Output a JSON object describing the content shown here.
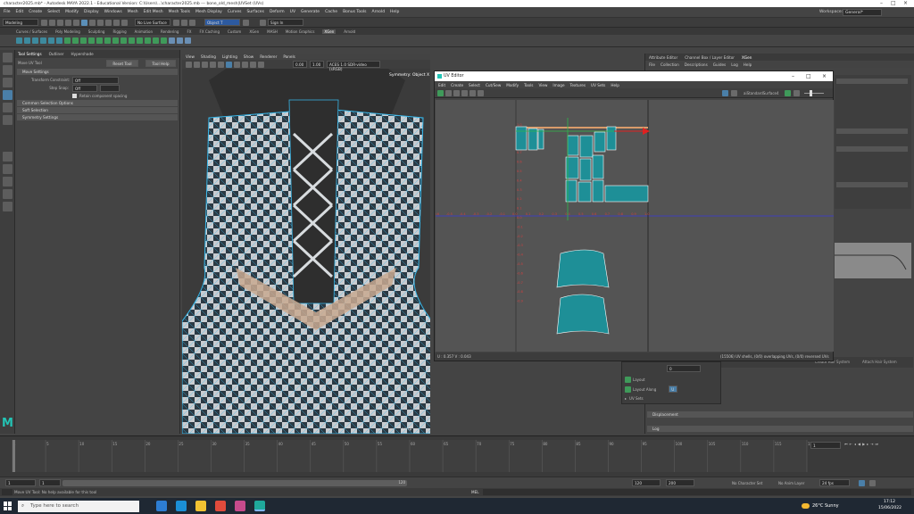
{
  "window": {
    "title": "character2025.mb* - Autodesk MAYA 2022.1 - Educational Version: C:\\Users\\...\\character2025.mb --- bone_old_mesh|UVSet (UVs)",
    "workspace_label": "Workspace:",
    "workspace_value": "General*"
  },
  "menubar": [
    "File",
    "Edit",
    "Create",
    "Select",
    "Modify",
    "Display",
    "Windows",
    "Mesh",
    "Edit Mesh",
    "Mesh Tools",
    "Mesh Display",
    "Curves",
    "Surfaces",
    "Deform",
    "UV",
    "Generate",
    "Cache",
    "Bonus Tools",
    "Arnold",
    "Help"
  ],
  "statusline": {
    "mode": "Modeling",
    "live_surface": "No Live Surface",
    "object_field": "Object T",
    "sign_in": "Sign In"
  },
  "shelf_tabs": [
    "Curves / Surfaces",
    "Poly Modeling",
    "Sculpting",
    "Rigging",
    "Animation",
    "Rendering",
    "FX",
    "FX Caching",
    "Custom",
    "XGen",
    "MASH",
    "Motion Graphics",
    "XGen",
    "Arnold"
  ],
  "tool_panel": {
    "tabs": [
      "Tool Settings",
      "Outliner",
      "Hypershade"
    ],
    "tool_name": "Move UV Tool",
    "reset_label": "Reset Tool",
    "help_label": "Tool Help",
    "sections": [
      "Move Settings",
      "Common Selection Options",
      "Soft Selection",
      "Symmetry Settings"
    ],
    "transform_constraint_label": "Transform Constraint:",
    "transform_constraint_value": "Off",
    "step_snap_label": "Step Snap:",
    "step_snap_value": "Off",
    "retain_label": "Retain component spacing"
  },
  "viewport": {
    "menu": [
      "View",
      "Shading",
      "Lighting",
      "Show",
      "Renderer",
      "Panels"
    ],
    "symmetry_label": "Symmetry: Object X",
    "field_a": "0.00",
    "field_b": "1.00",
    "colorspace": "ACES 1.0 SDR-video (sRGB)",
    "camera_label": "persp"
  },
  "uv_editor": {
    "title": "UV Editor",
    "menu": [
      "Edit",
      "Create",
      "Select",
      "Cut/Sew",
      "Modify",
      "Tools",
      "View",
      "Image",
      "Textures",
      "UV Sets",
      "Help"
    ],
    "shader_label": "aiStandardSurface4",
    "coords": "U : 0.357  V : 0.043",
    "shell_info": "(15506) UV shells, (0/0) overlapping UVs, (0/0) reversed UVs",
    "v_ticks": [
      "1.0",
      "0.9",
      "0.8",
      "0.7",
      "0.6",
      "0.5",
      "0.4",
      "0.3",
      "0.2",
      "0.1",
      "0.0",
      "-0.1",
      "-0.2",
      "-0.3",
      "-0.4",
      "-0.5",
      "-0.6",
      "-0.7",
      "-0.8",
      "-0.9"
    ],
    "u_ticks": [
      "-0.9",
      "-0.8",
      "-0.7",
      "-0.6",
      "-0.5",
      "-0.4",
      "-0.3",
      "-0.2",
      "-0.1",
      "0.0",
      "0.1",
      "0.2",
      "0.3",
      "0.4",
      "0.5",
      "0.6",
      "0.7",
      "0.8",
      "0.9",
      "1.0"
    ]
  },
  "attribute_editor": {
    "tabs": [
      "Attribute Editor",
      "Channel Box / Layer Editor",
      "XGen"
    ],
    "menu": [
      "File",
      "Collection",
      "Descriptions",
      "Guides",
      "Log",
      "Help"
    ],
    "layout_label": "Layout",
    "layout_along_label": "Layout Along",
    "layout_along_value": "U",
    "uv_sets_label": "UV Sets",
    "displacement_label": "Displacement",
    "log_label": "Log",
    "create_hair_label": "Create Hair System",
    "attach_hair_label": "Attach Hair System",
    "zero_value": "0"
  },
  "timeline": {
    "ticks": [
      "1",
      "5",
      "10",
      "15",
      "20",
      "25",
      "30",
      "35",
      "40",
      "45",
      "50",
      "55",
      "60",
      "65",
      "70",
      "75",
      "80",
      "85",
      "90",
      "95",
      "100",
      "105",
      "110",
      "115",
      "120"
    ],
    "current_frame": "1"
  },
  "range": {
    "start": "1",
    "inner_start": "1",
    "inner_end": "120",
    "end_a": "120",
    "end_b": "200",
    "character_set": "No Character Set",
    "anim_layer": "No Anim Layer",
    "fps": "24 fps"
  },
  "command_line": {
    "mel_label": "MEL",
    "help_text": "Move UV Tool: No help available for this tool"
  },
  "taskbar": {
    "search_placeholder": "Type here to search",
    "weather": "26°C  Sunny",
    "time": "17:12",
    "date": "15/06/2022"
  }
}
